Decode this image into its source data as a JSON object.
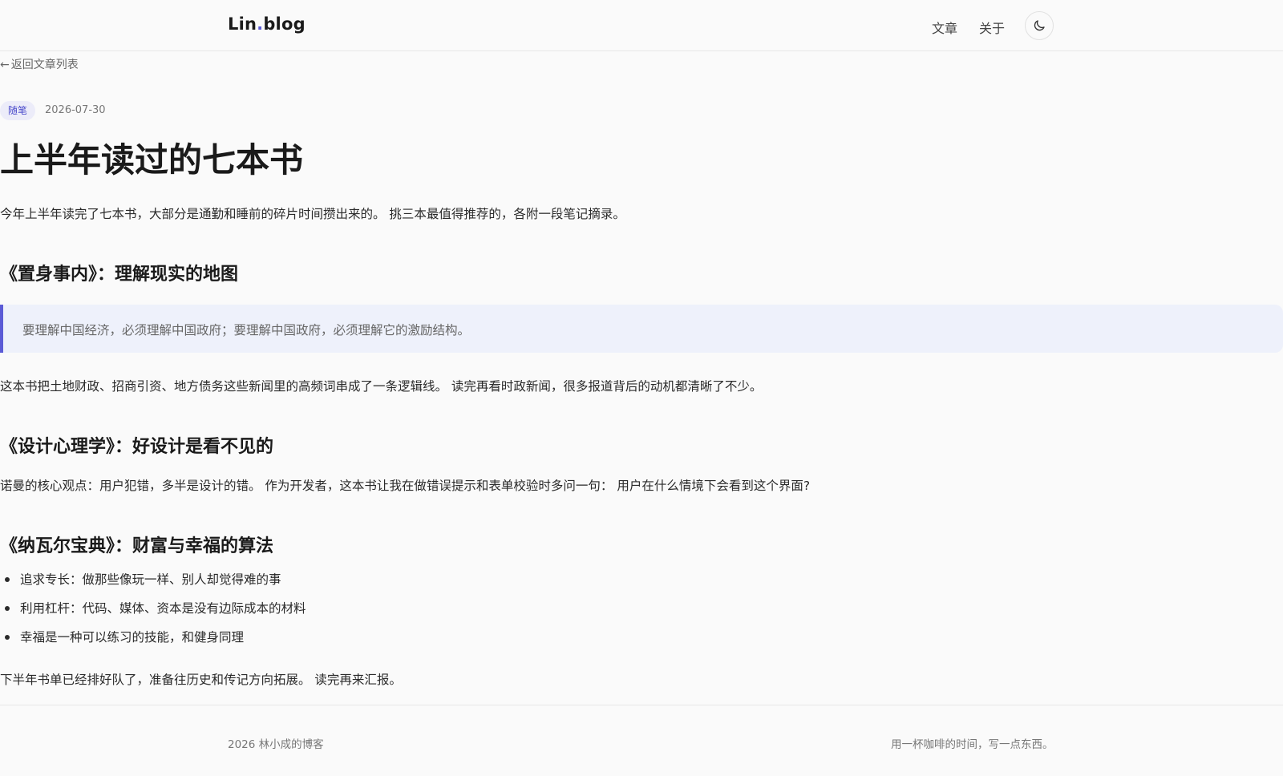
{
  "header": {
    "brand_prefix": "Lin",
    "brand_dot": ".",
    "brand_suffix": "blog",
    "nav": {
      "articles": "文章",
      "about": "关于"
    },
    "theme_icon": "moon-icon"
  },
  "back_link": {
    "arrow": "←",
    "label": "返回文章列表"
  },
  "post": {
    "tag": "随笔",
    "date": "2026-07-30",
    "title": "上半年读过的七本书",
    "intro": "今年上半年读完了七本书，大部分是通勤和睡前的碎片时间攒出来的。 挑三本最值得推荐的，各附一段笔记摘录。",
    "section1": {
      "heading": "《置身事内》：理解现实的地图",
      "quote": "要理解中国经济，必须理解中国政府；要理解中国政府，必须理解它的激励结构。",
      "body": "这本书把土地财政、招商引资、地方债务这些新闻里的高频词串成了一条逻辑线。 读完再看时政新闻，很多报道背后的动机都清晰了不少。"
    },
    "section2": {
      "heading": "《设计心理学》：好设计是看不见的",
      "body": "诺曼的核心观点：用户犯错，多半是设计的错。 作为开发者，这本书让我在做错误提示和表单校验时多问一句： 用户在什么情境下会看到这个界面?"
    },
    "section3": {
      "heading": "《纳瓦尔宝典》：财富与幸福的算法",
      "items": [
        "追求专长：做那些像玩一样、别人却觉得难的事",
        "利用杠杆：代码、媒体、资本是没有边际成本的材料",
        "幸福是一种可以练习的技能，和健身同理"
      ]
    },
    "outro": "下半年书单已经排好队了，准备往历史和传记方向拓展。 读完再来汇报。"
  },
  "footer": {
    "left": "2026 林小成的博客",
    "right": "用一杯咖啡的时间，写一点东西。"
  },
  "colors": {
    "accent": "#5b5bd6",
    "tag_bg": "#ececf9",
    "quote_bg": "#eef1fb",
    "page_bg": "#fafafa"
  }
}
